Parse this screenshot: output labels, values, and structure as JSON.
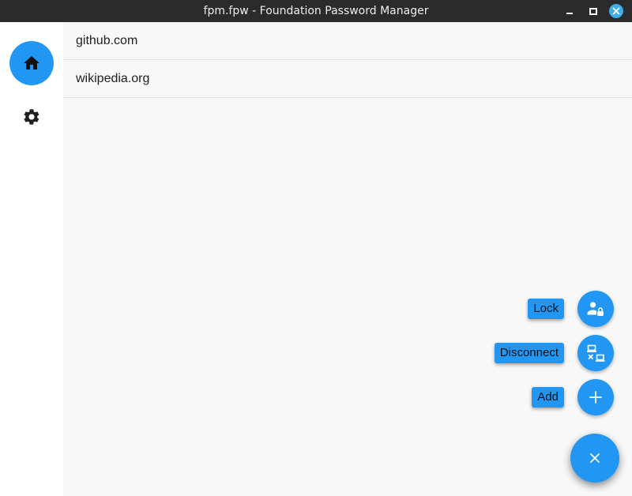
{
  "window": {
    "title": "fpm.fpw - Foundation Password Manager"
  },
  "navigation_rail": {
    "items": [
      {
        "icon": "home-icon",
        "selected": true
      },
      {
        "icon": "gear-icon",
        "selected": false
      }
    ]
  },
  "entries": [
    {
      "label": "github.com"
    },
    {
      "label": "wikipedia.org"
    }
  ],
  "speed_dial": {
    "actions": [
      {
        "label": "Lock",
        "icon": "person-lock-icon"
      },
      {
        "label": "Disconnect",
        "icon": "network-disconnect-icon"
      },
      {
        "label": "Add",
        "icon": "plus-icon"
      }
    ],
    "toggle_icon": "close-icon",
    "expanded": true
  },
  "colors": {
    "accent": "#2196f3",
    "titlebar": "#2b2b2b",
    "window_close": "#3daee9",
    "content_background": "#f8f8f8"
  }
}
